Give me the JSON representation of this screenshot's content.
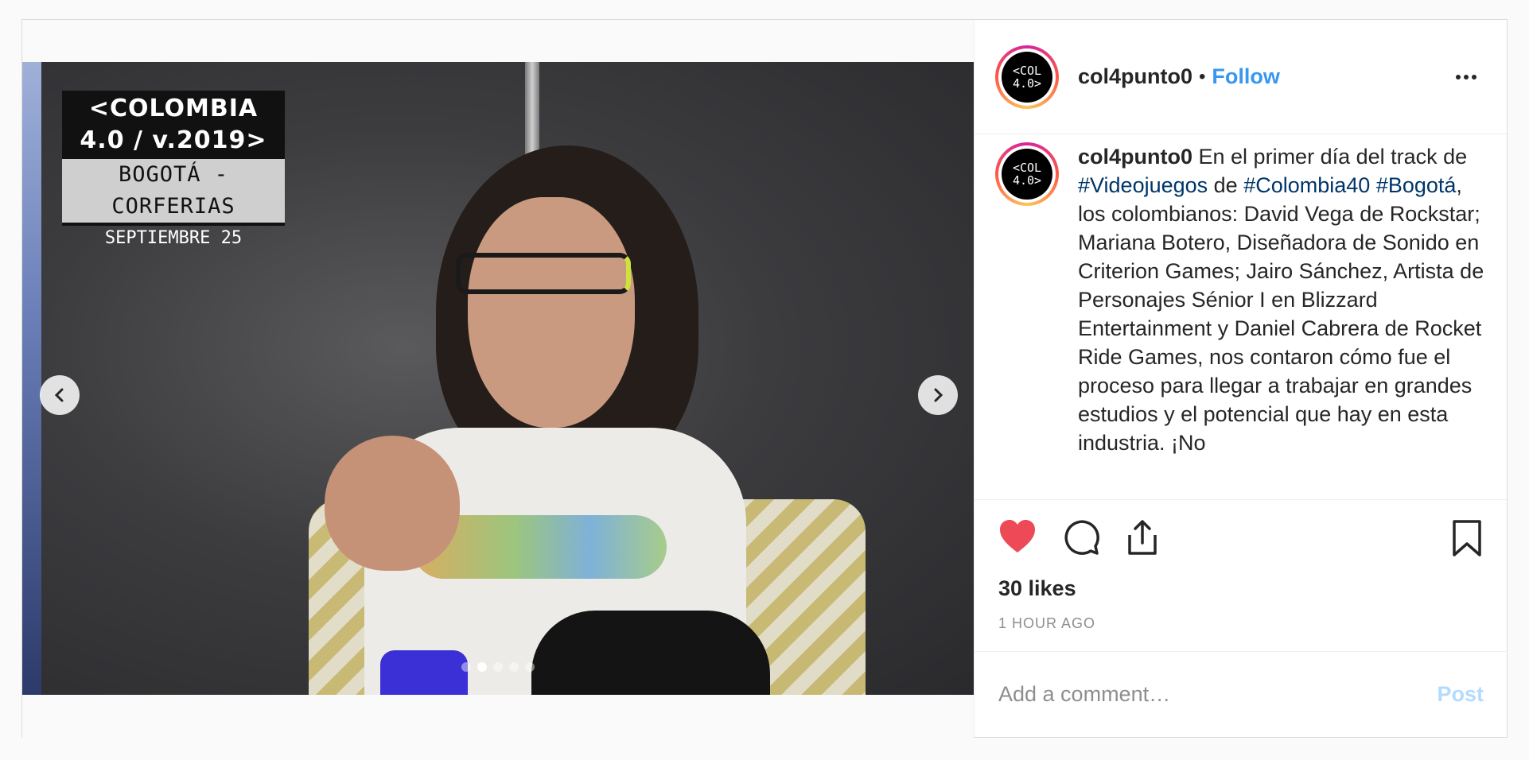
{
  "banner": {
    "line1": "<COLOMBIA",
    "line2": "4.0 / v.2019>",
    "line3": "BOGOTÁ - CORFERIAS",
    "line4": "SEPTIEMBRE 25"
  },
  "carousel": {
    "total": 5,
    "active_index": 1
  },
  "account": {
    "username": "col4punto0",
    "separator": "•",
    "follow_label": "Follow",
    "avatar_line1": "<COL",
    "avatar_line2": "4.0>"
  },
  "caption": {
    "username": "col4punto0",
    "part1": " En el primer día del track de ",
    "tag1": "#Videojuegos",
    "part2": " de ",
    "tag2": "#Colombia40",
    "part3": " ",
    "tag3": "#Bogotá",
    "part4": ", los colombianos: David Vega de Rockstar; Mariana Botero, Diseñadora de Sonido en Criterion Games; Jairo Sánchez, Artista de Personajes Sénior I en Blizzard Entertainment y Daniel Cabrera de Rocket Ride Games, nos contaron cómo fue el proceso para llegar a trabajar en grandes estudios y el potencial que hay en esta industria. ¡No"
  },
  "stats": {
    "likes": "30 likes",
    "time": "1 HOUR AGO"
  },
  "comment": {
    "placeholder": "Add a comment…",
    "post_label": "Post"
  },
  "colors": {
    "accent": "#3897f0",
    "like": "#ed4956",
    "hashtag": "#003569",
    "post_disabled": "#b3dbff"
  },
  "icons": [
    "chevron-left-icon",
    "chevron-right-icon",
    "more-icon",
    "heart-icon",
    "comment-icon",
    "share-icon",
    "bookmark-icon"
  ]
}
